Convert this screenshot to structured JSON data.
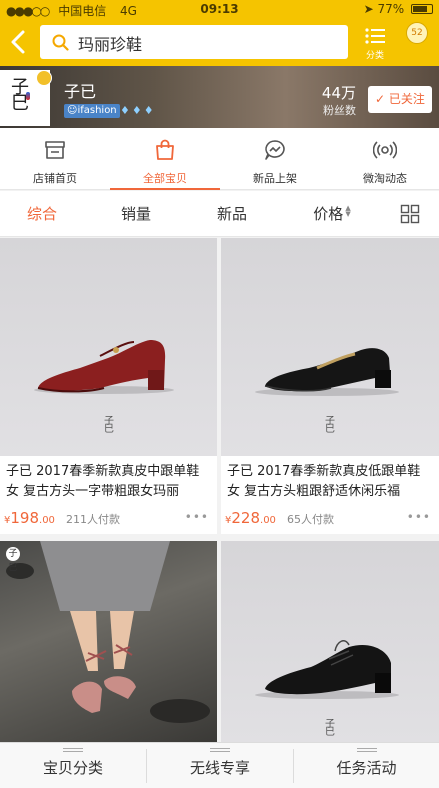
{
  "status_bar": {
    "carrier": "中国电信",
    "network": "4G",
    "time": "09:13",
    "battery": "77%",
    "battery_fraction": 0.77
  },
  "search": {
    "query": "玛丽珍鞋"
  },
  "top_bar": {
    "category_label": "分类",
    "more_badge": "52"
  },
  "shop": {
    "name": "子已",
    "logo_text": "子巳",
    "tag": "ifashion",
    "diamonds": "♦♦♦",
    "fans_count": "44万",
    "fans_label": "粉丝数",
    "follow_label": "已关注"
  },
  "shop_tabs": [
    {
      "label": "店铺首页",
      "icon": "store-icon"
    },
    {
      "label": "全部宝贝",
      "icon": "shopping-bag-icon",
      "active": true
    },
    {
      "label": "新品上架",
      "icon": "new-arrival-icon"
    },
    {
      "label": "微淘动态",
      "icon": "broadcast-icon"
    }
  ],
  "sort": {
    "items": [
      "综合",
      "销量",
      "新品",
      "价格"
    ],
    "active_index": 0
  },
  "products": [
    {
      "title": "子已 2017春季新款真皮中跟单鞋女 复古方头一字带粗跟女玛丽",
      "currency": "¥",
      "price_int": "198",
      "price_dec": ".00",
      "sold": "211人付款",
      "more": "•••"
    },
    {
      "title": "子已 2017春季新款真皮低跟单鞋女 复古方头粗跟舒适休闲乐福",
      "currency": "¥",
      "price_int": "228",
      "price_dec": ".00",
      "sold": "65人付款",
      "more": "•••"
    },
    {
      "title": "",
      "brand": "子巳"
    },
    {
      "title": "",
      "brand": "子巳"
    }
  ],
  "bottom_bar": {
    "items": [
      "宝贝分类",
      "无线专享",
      "任务活动"
    ]
  },
  "colors": {
    "brand_yellow": "#f5c400",
    "accent_orange": "#f0673a"
  }
}
